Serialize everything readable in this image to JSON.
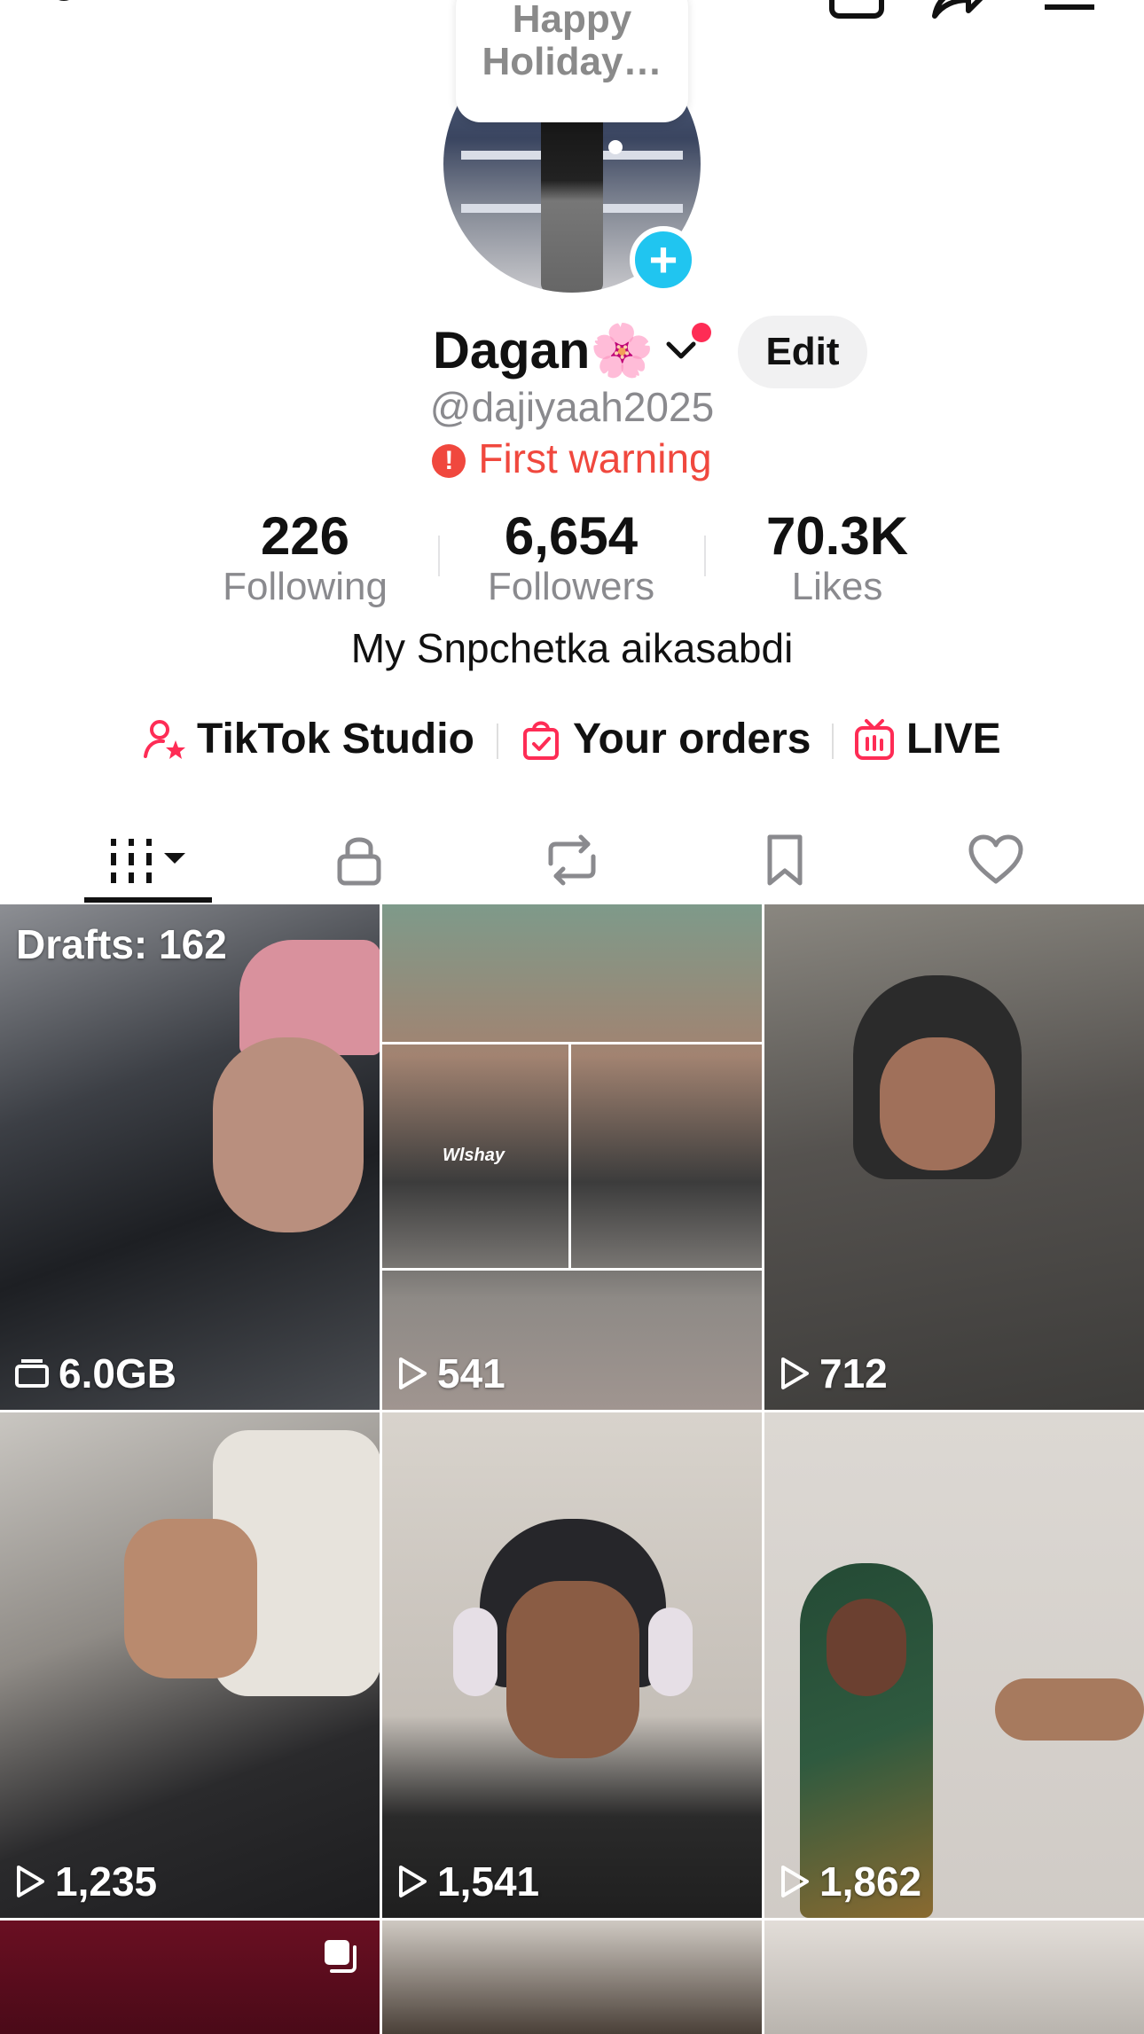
{
  "bubble": {
    "text": "Happy Holiday…"
  },
  "profile": {
    "display_name": "Dagan🌸",
    "username": "@dajiyaah2025",
    "warning": "First warning",
    "edit_label": "Edit",
    "bio": "My Snpchetka aikasabdi"
  },
  "stats": [
    {
      "value": "226",
      "label": "Following"
    },
    {
      "value": "6,654",
      "label": "Followers"
    },
    {
      "value": "70.3K",
      "label": "Likes"
    }
  ],
  "links": [
    {
      "label": "TikTok Studio",
      "icon": "creator-star-icon"
    },
    {
      "label": "Your orders",
      "icon": "shopping-bag-icon"
    },
    {
      "label": "LIVE",
      "icon": "tv-icon"
    }
  ],
  "tabs": [
    {
      "icon": "grid-icon",
      "active": true
    },
    {
      "icon": "lock-icon"
    },
    {
      "icon": "repost-icon"
    },
    {
      "icon": "bookmark-icon"
    },
    {
      "icon": "heart-icon"
    }
  ],
  "grid": [
    {
      "kind": "drafts",
      "label": "Drafts: 162",
      "size": "6.0GB"
    },
    {
      "kind": "video",
      "views": "541",
      "overlay_text": "Wlshay"
    },
    {
      "kind": "video",
      "views": "712"
    },
    {
      "kind": "video",
      "views": "1,235"
    },
    {
      "kind": "video",
      "views": "1,541"
    },
    {
      "kind": "video",
      "views": "1,862"
    }
  ],
  "colors": {
    "accent_red": "#fe2c55",
    "warning_red": "#f0483e",
    "plus_blue": "#20c5f0",
    "muted_text": "#8a8a8e"
  }
}
